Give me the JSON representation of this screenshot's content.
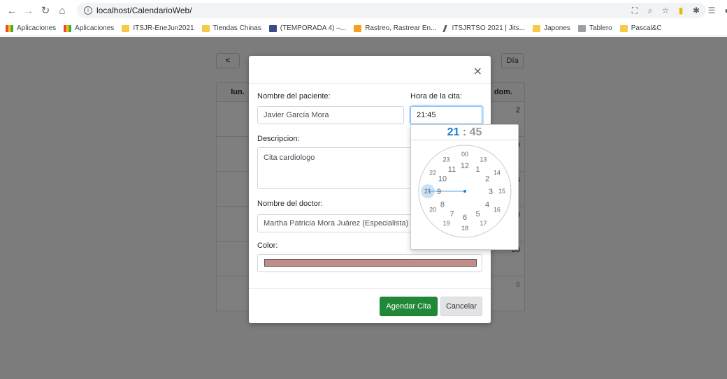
{
  "browser": {
    "url": "localhost/CalendarioWeb/",
    "bookmarks": [
      "Aplicaciones",
      "Aplicaciones",
      "ITSJR-EneJun2021",
      "Tiendas Chinas",
      "(TEMPORADA 4) –...",
      "Rastreo, Rastrear En...",
      "ITSJRTSO 2021 | Jits...",
      "Japones",
      "Tablero",
      "Pascal&C"
    ]
  },
  "calendar": {
    "prev_label": "<",
    "view_day_label": "Día",
    "head_first": "lun.",
    "head_last": "dom.",
    "row_numbers": [
      "2",
      "9",
      "6",
      "3",
      "30",
      "6"
    ]
  },
  "modal": {
    "patient_label": "Nombre del paciente:",
    "patient_value": "Javier García Mora",
    "time_label": "Hora de la cita:",
    "time_value": "21:45",
    "description_label": "Descripcion:",
    "description_value": "Cita cardiologo",
    "doctor_label": "Nombre del doctor:",
    "doctor_value": "Martha Patricia Mora Juárez (Especialista)",
    "color_label": "Color:",
    "color_value": "#c48b8b",
    "schedule_button": "Agendar Cita",
    "cancel_button": "Cancelar",
    "close_symbol": "×"
  },
  "clockpicker": {
    "hours": "21",
    "colon": ":",
    "minutes": "45",
    "outer_ring": [
      "00",
      "13",
      "14",
      "15",
      "16",
      "17",
      "18",
      "19",
      "20",
      "21",
      "22",
      "23"
    ],
    "inner_ring": [
      "12",
      "1",
      "2",
      "3",
      "4",
      "5",
      "6",
      "7",
      "8",
      "9",
      "10",
      "11"
    ],
    "selected_hour": "21",
    "accent": "#1e7bd6"
  }
}
